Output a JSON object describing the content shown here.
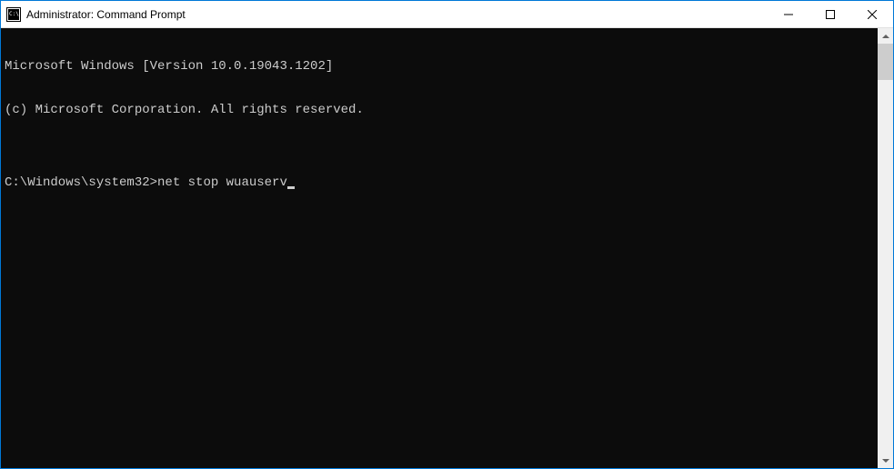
{
  "window": {
    "title": "Administrator: Command Prompt"
  },
  "console": {
    "line1": "Microsoft Windows [Version 10.0.19043.1202]",
    "line2": "(c) Microsoft Corporation. All rights reserved.",
    "blank": "",
    "prompt": "C:\\Windows\\system32>",
    "command": "net stop wuauserv"
  }
}
